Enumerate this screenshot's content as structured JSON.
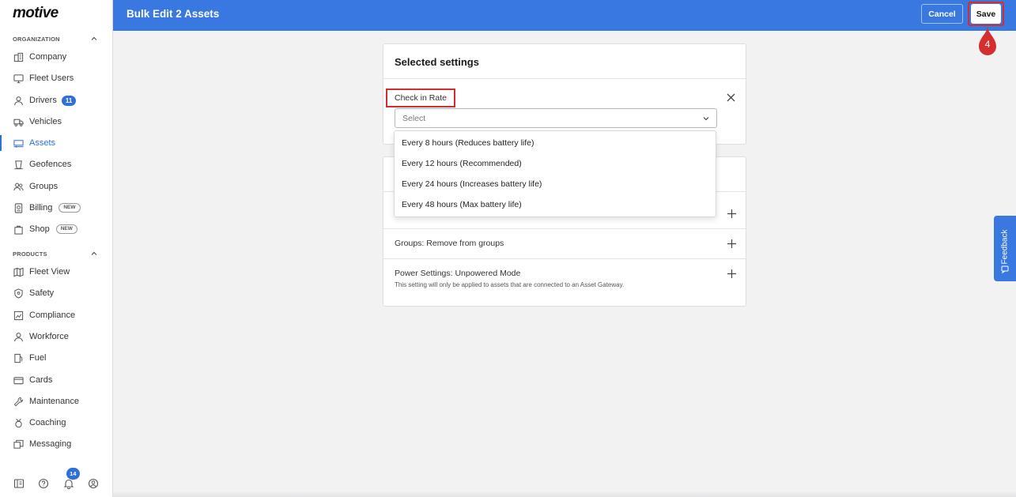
{
  "app": {
    "logo": "motive"
  },
  "sidebar": {
    "org_header": "ORGANIZATION",
    "products_header": "PRODUCTS",
    "org_items": [
      {
        "label": "Company",
        "icon": "building-icon"
      },
      {
        "label": "Fleet Users",
        "icon": "monitor-icon"
      },
      {
        "label": "Drivers",
        "icon": "person-icon",
        "badge": "11"
      },
      {
        "label": "Vehicles",
        "icon": "truck-icon"
      },
      {
        "label": "Assets",
        "icon": "trailer-icon",
        "active": true
      },
      {
        "label": "Geofences",
        "icon": "geofence-icon"
      },
      {
        "label": "Groups",
        "icon": "group-icon"
      },
      {
        "label": "Billing",
        "icon": "billing-icon",
        "tag": "NEW"
      },
      {
        "label": "Shop",
        "icon": "shopping-bag-icon",
        "tag": "NEW"
      }
    ],
    "product_items": [
      {
        "label": "Fleet View",
        "icon": "map-icon"
      },
      {
        "label": "Safety",
        "icon": "shield-icon"
      },
      {
        "label": "Compliance",
        "icon": "compliance-icon"
      },
      {
        "label": "Workforce",
        "icon": "person-icon"
      },
      {
        "label": "Fuel",
        "icon": "fuel-icon"
      },
      {
        "label": "Cards",
        "icon": "card-icon"
      },
      {
        "label": "Maintenance",
        "icon": "wrench-icon"
      },
      {
        "label": "Coaching",
        "icon": "coaching-icon"
      },
      {
        "label": "Messaging",
        "icon": "messaging-icon"
      }
    ],
    "notifications_count": "14"
  },
  "header": {
    "title": "Bulk Edit 2 Assets",
    "cancel_label": "Cancel",
    "save_label": "Save"
  },
  "step_marker": "4",
  "selected_card": {
    "title": "Selected settings",
    "field_label": "Check in Rate",
    "select_placeholder": "Select"
  },
  "dropdown_options": [
    "Every 8 hours (Reduces battery life)",
    "Every 12 hours (Recommended)",
    "Every 24 hours (Increases battery life)",
    "Every 48 hours (Max battery life)"
  ],
  "available_card": {
    "rows": [
      {
        "label": "Groups: Remove from groups"
      },
      {
        "label": "Power Settings: Unpowered Mode",
        "sub": "This setting will only be applied to assets that are connected to an Asset Gateway."
      }
    ]
  },
  "feedback_label": "Feedback",
  "colors": {
    "brand_blue": "#3878e0",
    "highlight_red": "#d62e2e"
  }
}
